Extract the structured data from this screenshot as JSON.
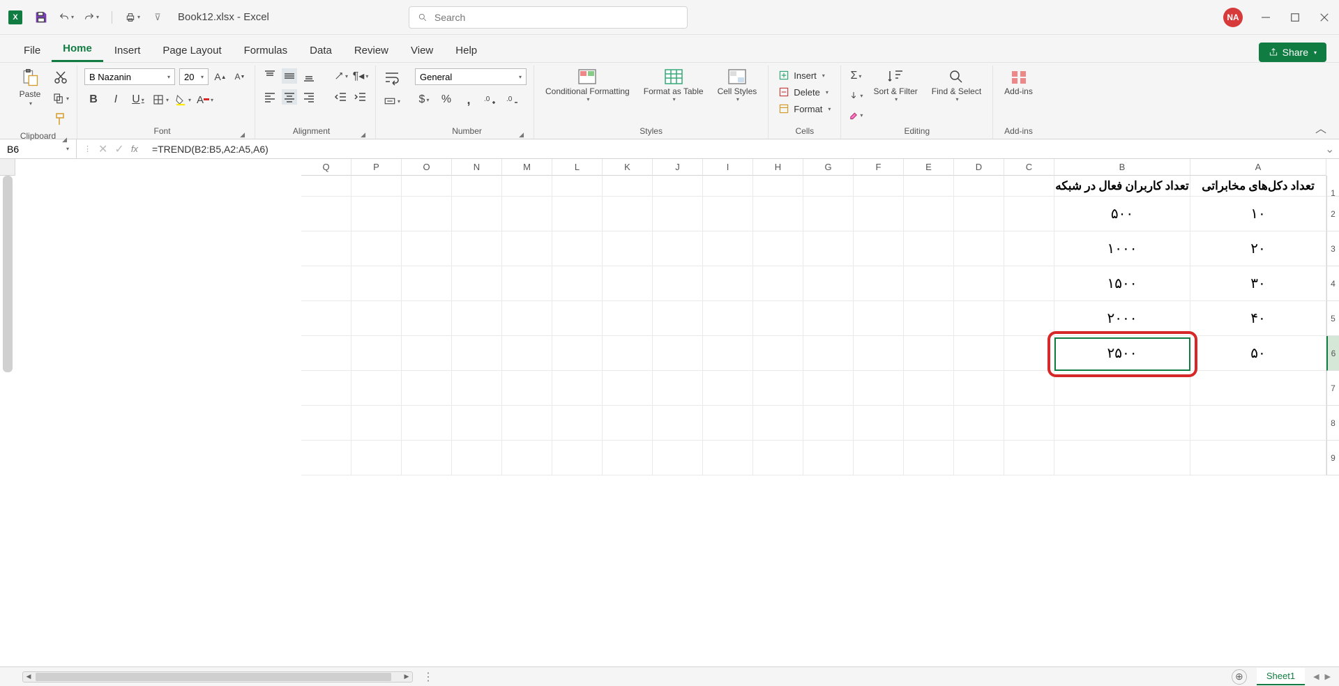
{
  "title": "Book12.xlsx - Excel",
  "user_initials": "NA",
  "search_placeholder": "Search",
  "tabs": {
    "file": "File",
    "home": "Home",
    "insert": "Insert",
    "page_layout": "Page Layout",
    "formulas": "Formulas",
    "data": "Data",
    "review": "Review",
    "view": "View",
    "help": "Help"
  },
  "share": "Share",
  "ribbon": {
    "clipboard": {
      "label": "Clipboard",
      "paste": "Paste"
    },
    "font": {
      "label": "Font",
      "name": "B Nazanin",
      "size": "20"
    },
    "alignment": {
      "label": "Alignment"
    },
    "number": {
      "label": "Number",
      "format": "General"
    },
    "styles": {
      "label": "Styles",
      "cond": "Conditional Formatting",
      "table": "Format as Table",
      "cell": "Cell Styles"
    },
    "cells": {
      "label": "Cells",
      "insert": "Insert",
      "delete": "Delete",
      "format": "Format"
    },
    "editing": {
      "label": "Editing",
      "sort": "Sort & Filter",
      "find": "Find & Select"
    },
    "addins": {
      "label": "Add-ins",
      "btn": "Add-ins"
    }
  },
  "namebox": "B6",
  "formula": "=TREND(B2:B5,A2:A5,A6)",
  "columns": [
    "A",
    "B",
    "C",
    "D",
    "E",
    "F",
    "G",
    "H",
    "I",
    "J",
    "K",
    "L",
    "M",
    "N",
    "O",
    "P",
    "Q"
  ],
  "rows": [
    "1",
    "2",
    "3",
    "4",
    "5",
    "6",
    "7",
    "8",
    "9"
  ],
  "cells": {
    "A1": "تعداد دکل‌های مخابراتی",
    "B1": "تعداد کاربران فعال در شبکه",
    "A2": "۱۰",
    "B2": "۵۰۰",
    "A3": "۲۰",
    "B3": "۱۰۰۰",
    "A4": "۳۰",
    "B4": "۱۵۰۰",
    "A5": "۴۰",
    "B5": "۲۰۰۰",
    "A6": "۵۰",
    "B6": "۲۵۰۰"
  },
  "sheet_tab": "Sheet1"
}
